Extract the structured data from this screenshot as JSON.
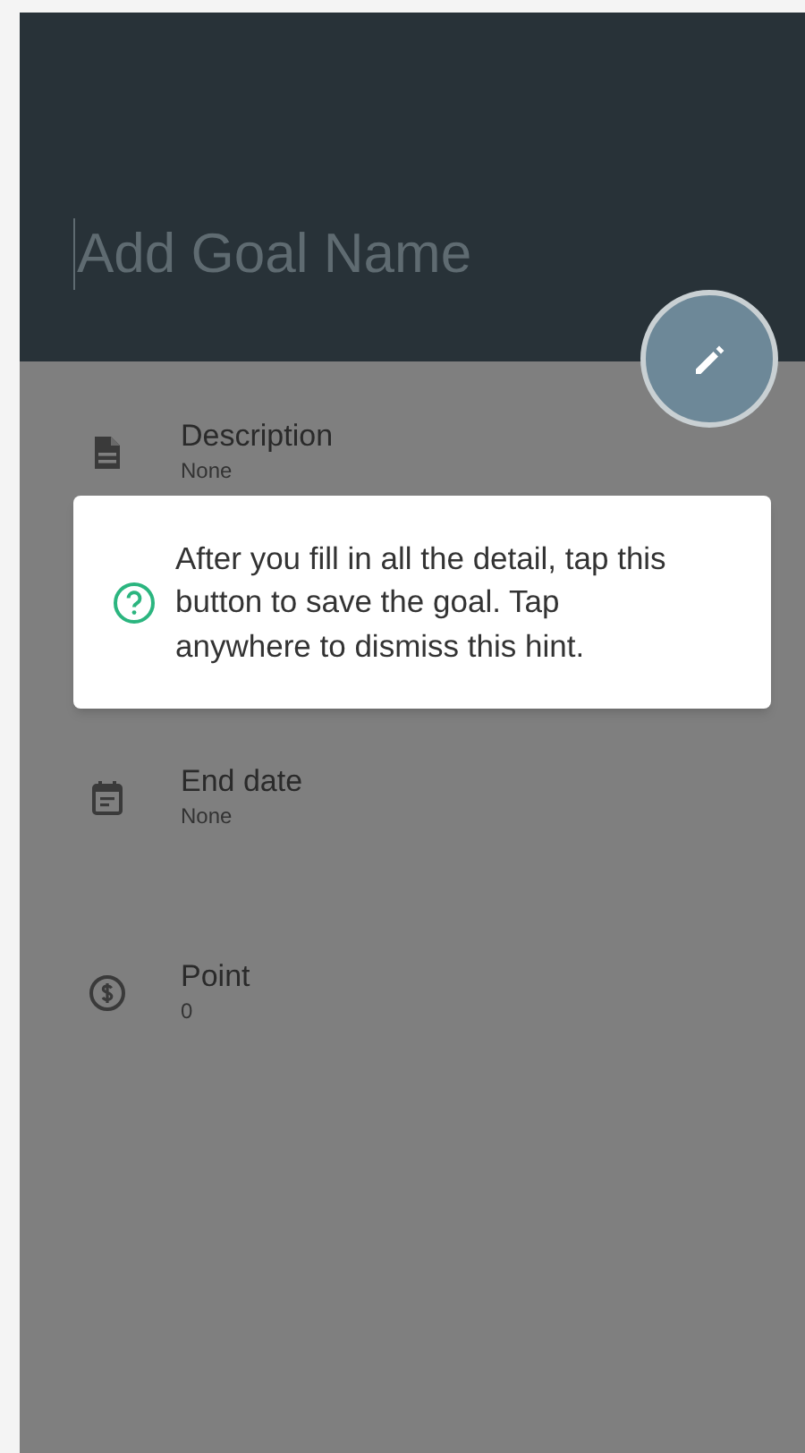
{
  "header": {
    "placeholder": "Add Goal Name"
  },
  "fields": [
    {
      "kind": "document",
      "label": "Description",
      "value": "None"
    },
    {
      "kind": "calendar",
      "label": "End date",
      "value": "None"
    },
    {
      "kind": "coin",
      "label": "Point",
      "value": "0"
    }
  ],
  "hint": {
    "text": "After you fill in all the detail, tap this button to save the goal. Tap anywhere to dismiss this hint."
  }
}
